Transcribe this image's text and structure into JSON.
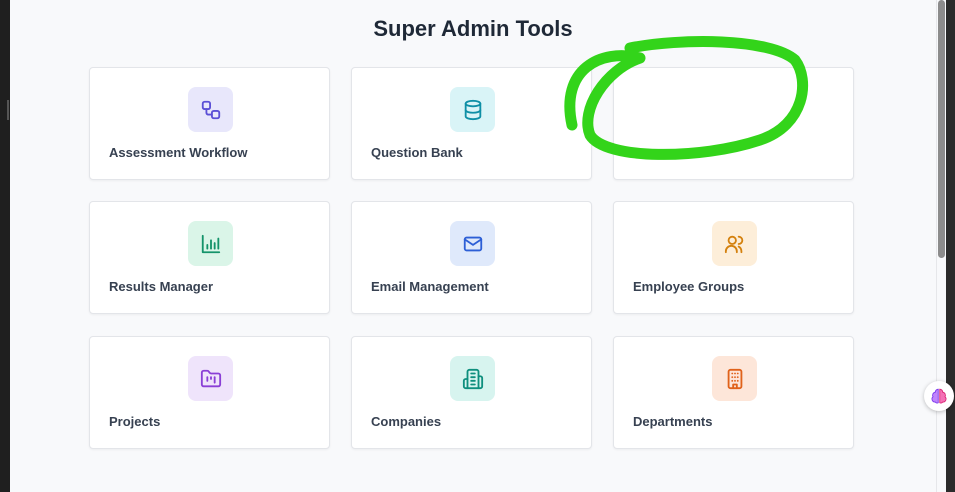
{
  "page": {
    "title": "Super Admin Tools"
  },
  "cards": [
    {
      "label": "Assessment Workflow",
      "icon": "workflow-icon",
      "icon_bg": "#e8e7fb",
      "icon_color": "#5b4fd6"
    },
    {
      "label": "Question Bank",
      "icon": "database-icon",
      "icon_bg": "#d9f4f7",
      "icon_color": "#0e8fa6"
    },
    {
      "label": "",
      "icon": "",
      "icon_bg": "",
      "icon_color": ""
    },
    {
      "label": "Results Manager",
      "icon": "bar-chart-icon",
      "icon_bg": "#daf5e8",
      "icon_color": "#14936a"
    },
    {
      "label": "Email Management",
      "icon": "mail-icon",
      "icon_bg": "#dfe9fb",
      "icon_color": "#2d5fd6"
    },
    {
      "label": "Employee Groups",
      "icon": "users-icon",
      "icon_bg": "#fdeed9",
      "icon_color": "#d4810e"
    },
    {
      "label": "Projects",
      "icon": "folder-kanban-icon",
      "icon_bg": "#efe4fb",
      "icon_color": "#8a3fd6"
    },
    {
      "label": "Companies",
      "icon": "building-icon",
      "icon_bg": "#d7f4ef",
      "icon_color": "#0f8f7e"
    },
    {
      "label": "Departments",
      "icon": "office-building-icon",
      "icon_bg": "#fde6d9",
      "icon_color": "#e0621a"
    }
  ],
  "annotation": {
    "color": "#33d41a"
  },
  "floating_button": {
    "icon": "brain-icon"
  }
}
